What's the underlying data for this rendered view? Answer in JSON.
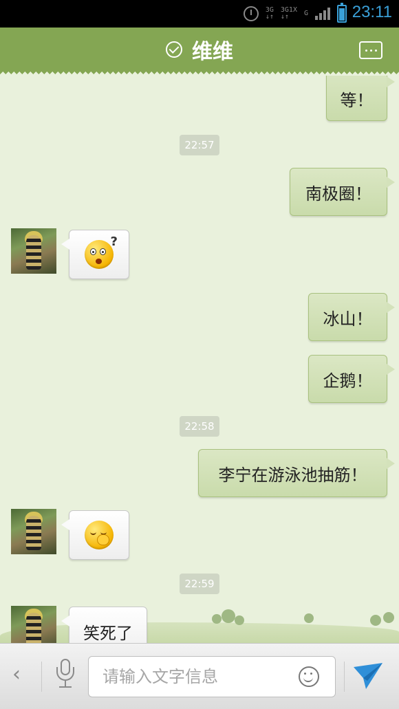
{
  "status_bar": {
    "time": "23:11",
    "network_labels": [
      "3G",
      "3G",
      "1X",
      "G"
    ]
  },
  "header": {
    "title": "维维",
    "icons": [
      "check-circle-icon",
      "more-menu-icon"
    ]
  },
  "messages": [
    {
      "type": "outgoing",
      "text": "等！"
    },
    {
      "type": "time",
      "text": "22:57"
    },
    {
      "type": "outgoing",
      "text": "南极圈！"
    },
    {
      "type": "incoming",
      "emoji": "confused-face-emoji"
    },
    {
      "type": "outgoing",
      "text": "冰山！"
    },
    {
      "type": "outgoing",
      "text": "企鹅！"
    },
    {
      "type": "time",
      "text": "22:58"
    },
    {
      "type": "outgoing",
      "text": "李宁在游泳池抽筋！"
    },
    {
      "type": "incoming",
      "emoji": "giggle-face-emoji"
    },
    {
      "type": "time",
      "text": "22:59"
    },
    {
      "type": "incoming",
      "text": "笑死了"
    }
  ],
  "input_bar": {
    "placeholder": "请输入文字信息",
    "icons": [
      "back-chevron-icon",
      "microphone-icon",
      "smiley-icon",
      "send-icon"
    ]
  },
  "colors": {
    "header": "#84a653",
    "chat_bg": "#e9f1dc",
    "outgoing_bubble": "#d4e2bb",
    "incoming_bubble": "#f7f7f7",
    "status_accent": "#3aa0d8"
  }
}
